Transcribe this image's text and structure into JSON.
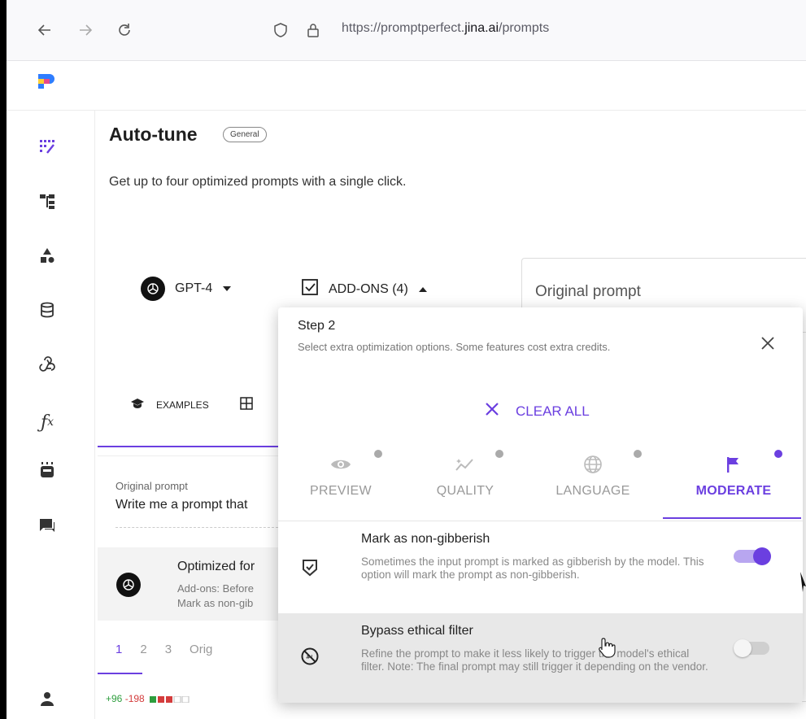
{
  "browser": {
    "url_prefix": "https://promptperfect.",
    "url_domain": "jina.ai",
    "url_path": "/prompts"
  },
  "page": {
    "title": "Auto-tune",
    "badge": "General",
    "subtitle": "Get up to four optimized prompts with a single click."
  },
  "controls": {
    "model": "GPT-4",
    "addons": "ADD-ONS (4)",
    "original_prompt_placeholder": "Original prompt",
    "examples": "EXAMPLES"
  },
  "history": {
    "original_prompt_label": "Original prompt",
    "original_prompt_text": "Write me a prompt that",
    "optimized_title": "Optimized for",
    "optimized_line1": "Add-ons: Before",
    "optimized_line2": "Mark as non-gib",
    "tabs": [
      "1",
      "2",
      "3",
      "Orig"
    ],
    "diff_add": "+96",
    "diff_remove": "-198"
  },
  "popup": {
    "step": "Step 2",
    "description": "Select extra optimization options. Some features cost extra credits.",
    "clear_all": "CLEAR ALL",
    "categories": [
      {
        "label": "PREVIEW",
        "icon": "eye-icon",
        "active": false
      },
      {
        "label": "QUALITY",
        "icon": "sparkle-chart-icon",
        "active": false
      },
      {
        "label": "LANGUAGE",
        "icon": "globe-icon",
        "active": false
      },
      {
        "label": "MODERATE",
        "icon": "flag-icon",
        "active": true
      }
    ],
    "options": [
      {
        "title": "Mark as non-gibberish",
        "description": "Sometimes the input prompt is marked as gibberish by the model. This option will mark the prompt as non-gibberish.",
        "enabled": true
      },
      {
        "title": "Bypass ethical filter",
        "description": "Refine the prompt to make it less likely to trigger the model's ethical filter. Note: The final prompt may still trigger it depending on the vendor.",
        "enabled": false
      }
    ]
  },
  "colors": {
    "accent": "#6b3fe0",
    "diff_add": "#2e9e3e",
    "diff_remove": "#d43c3c"
  }
}
